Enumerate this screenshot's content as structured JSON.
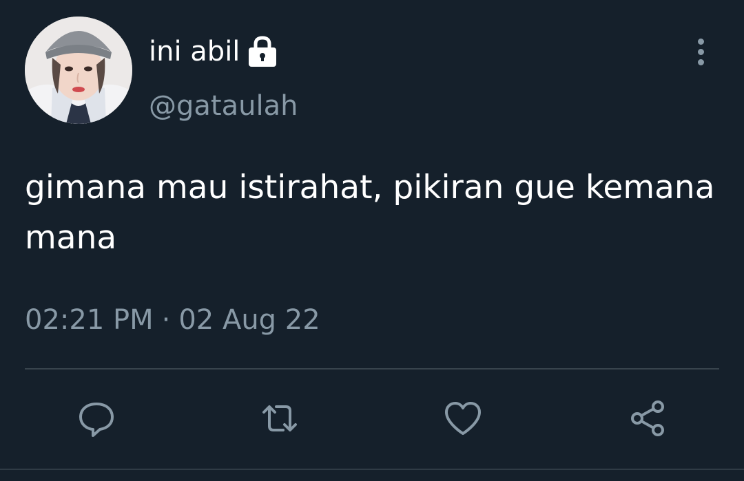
{
  "user": {
    "display_name": "ini abil",
    "handle": "@gataulah",
    "protected_icon": "lock-icon"
  },
  "tweet": {
    "text": "gimana mau istirahat, pikiran gue kemana mana",
    "time": "02:21 PM",
    "separator": "·",
    "date": "02 Aug 22"
  },
  "actions": {
    "reply_icon": "reply-icon",
    "retweet_icon": "retweet-icon",
    "like_icon": "heart-icon",
    "share_icon": "share-icon"
  },
  "colors": {
    "background": "#15202b",
    "primary_text": "#ffffff",
    "secondary_text": "#8899a6",
    "divider": "#38444d"
  }
}
